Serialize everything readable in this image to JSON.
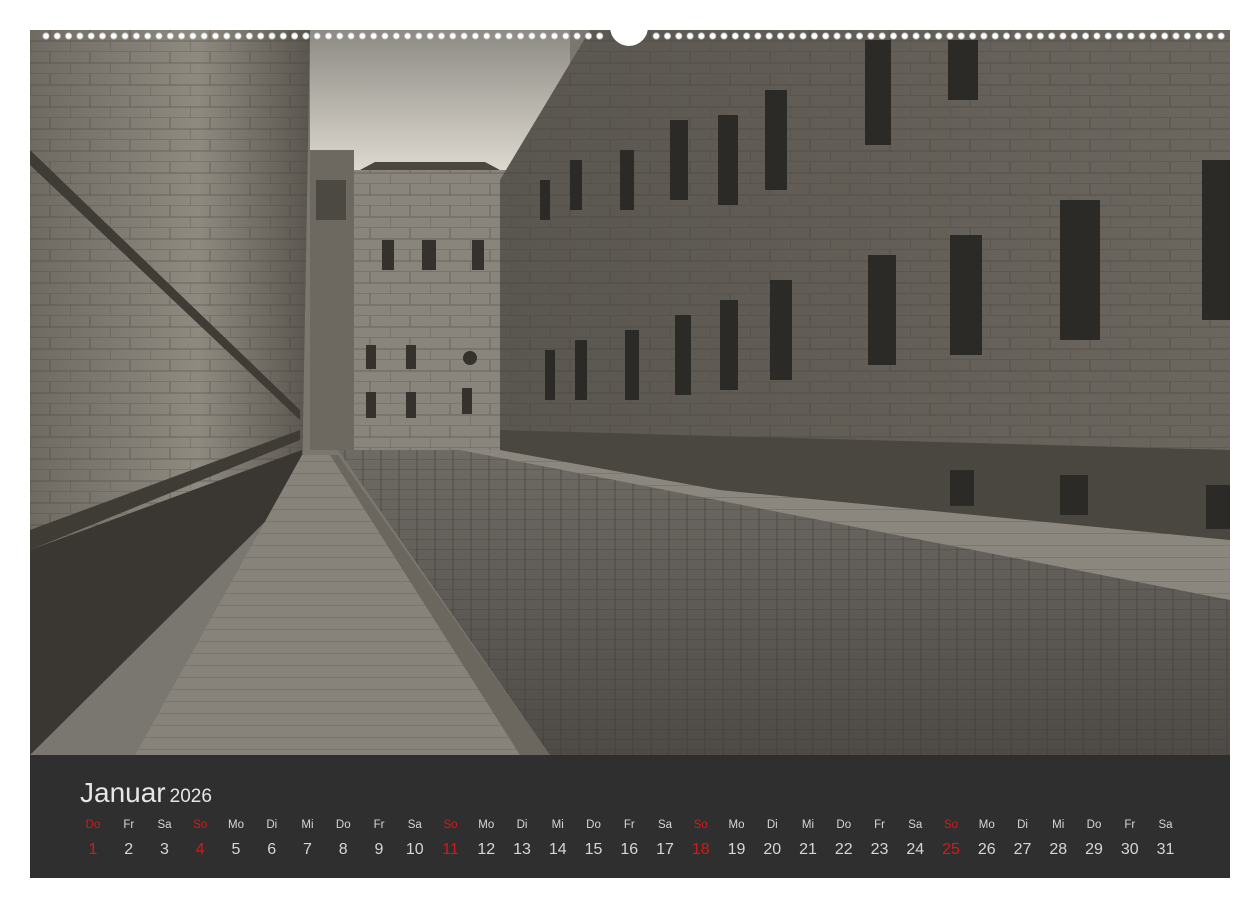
{
  "calendar": {
    "month": "Januar",
    "year": "2026",
    "sunday_color": "#d81818",
    "weekdays": [
      "Do",
      "Fr",
      "Sa",
      "So",
      "Mo",
      "Di",
      "Mi",
      "Do",
      "Fr",
      "Sa",
      "So",
      "Mo",
      "Di",
      "Mi",
      "Do",
      "Fr",
      "Sa",
      "So",
      "Mo",
      "Di",
      "Mi",
      "Do",
      "Fr",
      "Sa",
      "So",
      "Mo",
      "Di",
      "Mi",
      "Do",
      "Fr",
      "Sa"
    ],
    "days": [
      "1",
      "2",
      "3",
      "4",
      "5",
      "6",
      "7",
      "8",
      "9",
      "10",
      "11",
      "12",
      "13",
      "14",
      "15",
      "16",
      "17",
      "18",
      "19",
      "20",
      "21",
      "22",
      "23",
      "24",
      "25",
      "26",
      "27",
      "28",
      "29",
      "30",
      "31"
    ],
    "sunday_indices": [
      0,
      3,
      10,
      17,
      24
    ]
  },
  "photo": {
    "subject": "cobblestone-street-historic-buildings",
    "tone": "sepia-monochrome"
  }
}
